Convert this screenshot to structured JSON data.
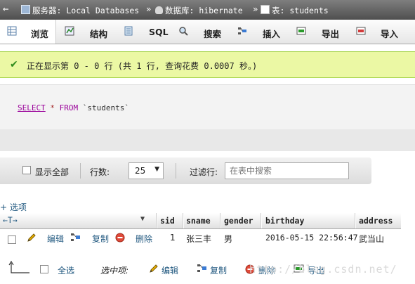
{
  "breadcrumb": {
    "server_label": "服务器: Local Databases",
    "db_label": "数据库: hibernate",
    "table_label": "表: students",
    "separator": "»"
  },
  "tabs": [
    {
      "label": "浏览",
      "icon": "table-icon"
    },
    {
      "label": "结构",
      "icon": "structure-icon"
    },
    {
      "label": "SQL",
      "icon": "sql-icon"
    },
    {
      "label": "搜索",
      "icon": "search-icon"
    },
    {
      "label": "插入",
      "icon": "insert-icon"
    },
    {
      "label": "导出",
      "icon": "export-icon"
    },
    {
      "label": "导入",
      "icon": "import-icon"
    }
  ],
  "message": "正在显示第 0 - 0 行 (共 1 行, 查询花费 0.0007 秒。)",
  "sql": {
    "select": "SELECT",
    "star": "*",
    "from": "FROM",
    "table": "`students`"
  },
  "nav": {
    "show_all": "显示全部",
    "rows_label": "行数:",
    "rows_value": "25",
    "filter_label": "过滤行:",
    "filter_placeholder": "在表中搜索"
  },
  "options_link": "+ 选项",
  "table": {
    "columns": [
      "sid",
      "sname",
      "gender",
      "birthday",
      "address"
    ],
    "rows": [
      {
        "edit": "编辑",
        "copy": "复制",
        "delete": "删除",
        "sid": "1",
        "sname": "张三丰",
        "gender": "男",
        "birthday": "2016-05-15 22:56:47",
        "address": "武当山"
      }
    ]
  },
  "footer": {
    "select_all": "全选",
    "with_selected": "选中项:",
    "edit": "编辑",
    "copy": "复制",
    "delete": "删除",
    "export": "导出"
  },
  "watermark": "http://blog.csdn.net/",
  "colors": {
    "accent": "#235a81",
    "success_bg": "#ebf8a4",
    "success_border": "#a2d246",
    "sql_keyword": "#990099"
  }
}
